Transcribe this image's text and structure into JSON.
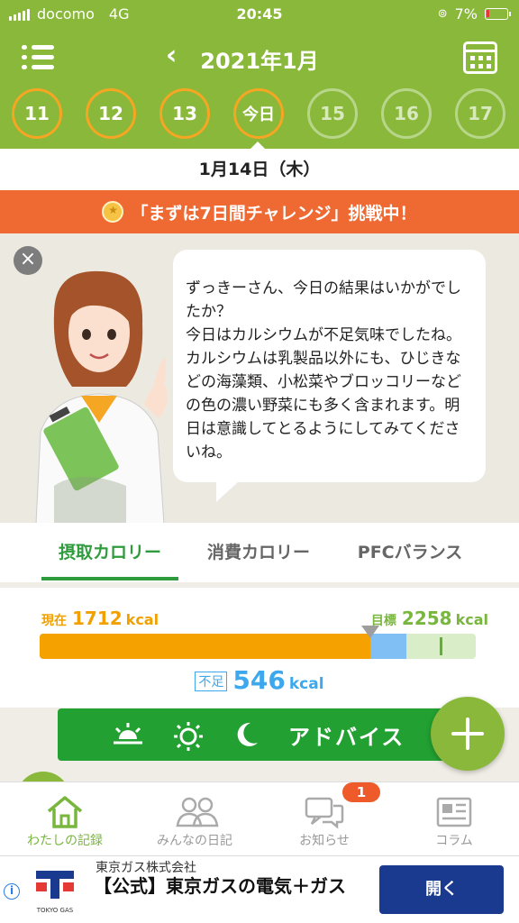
{
  "status_bar": {
    "carrier": "docomo",
    "network": "4G",
    "time": "20:45",
    "battery": "7%"
  },
  "header": {
    "title": "2021年1月",
    "back_icon": "chevron-left-icon",
    "menu_icon": "list-menu-icon",
    "calendar_icon": "calendar-icon"
  },
  "days": [
    {
      "label": "11",
      "state": "past"
    },
    {
      "label": "12",
      "state": "past"
    },
    {
      "label": "13",
      "state": "past"
    },
    {
      "label": "今日",
      "state": "today"
    },
    {
      "label": "15",
      "state": "future"
    },
    {
      "label": "16",
      "state": "future"
    },
    {
      "label": "17",
      "state": "future"
    }
  ],
  "date_label": "1月14日（木）",
  "challenge": {
    "text": "「まずは7日間チャレンジ」挑戦中！",
    "icon": "medal-icon"
  },
  "advice": {
    "message": "ずっきーさん、今日の結果はいかがでしたか？\n今日はカルシウムが不足気味でしたね。カルシウムは乳製品以外にも、ひじきなどの海藻類、小松菜やブロッコリーなどの色の濃い野菜にも多く含まれます。明日は意識してとるようにしてみてくださいね。"
  },
  "tabs": [
    {
      "label": "摂取カロリー",
      "active": true
    },
    {
      "label": "消費カロリー",
      "active": false
    },
    {
      "label": "PFCバランス",
      "active": false
    }
  ],
  "calories": {
    "current_label": "現在",
    "current_value": "1712",
    "goal_label": "目標",
    "goal_value": "2258",
    "unit": "kcal",
    "shortfall_label": "不足",
    "shortfall_value": "546",
    "current_fraction": 0.758,
    "goal_fraction": 0.916
  },
  "advice_button": {
    "label": "アドバイス",
    "icons": [
      "sunrise-icon",
      "sun-icon",
      "moon-icon"
    ]
  },
  "bottom_nav": [
    {
      "label": "わたしの記録",
      "icon": "home-icon",
      "active": true
    },
    {
      "label": "みんなの日記",
      "icon": "people-icon",
      "active": false
    },
    {
      "label": "お知らせ",
      "icon": "chat-icon",
      "active": false,
      "badge": "1"
    },
    {
      "label": "コラム",
      "icon": "newspaper-icon",
      "active": false
    }
  ],
  "ad": {
    "advertiser": "東京ガス株式会社",
    "title": "【公式】東京ガスの電気＋ガス",
    "cta": "開く",
    "logo_text": "TOKYO GAS"
  },
  "colors": {
    "brand_green": "#8ab83a",
    "accent_orange": "#ef6a33",
    "kcal_current": "#f5a200",
    "kcal_short": "#7fbff4",
    "active_tab": "#2e9b3c"
  }
}
